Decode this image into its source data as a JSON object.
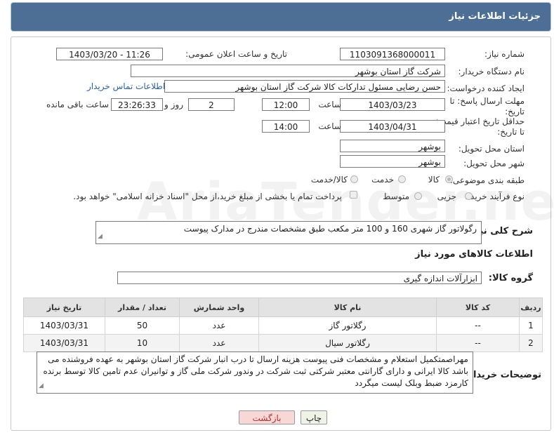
{
  "header": {
    "title": "جزئیات اطلاعات نیاز"
  },
  "watermark": "AriaTender.net",
  "fields": {
    "need_number_label": "شماره نیاز:",
    "need_number": "1103091368000011",
    "announce_label": "تاریخ و ساعت اعلان عمومی:",
    "announce_value": "1403/03/20 - 11:26",
    "buyer_org_label": "نام دستگاه خریدار:",
    "buyer_org": "شرکت گاز استان بوشهر",
    "requester_label": "ایجاد کننده درخواست:",
    "requester": "حسن رضایی مسئول تدارکات کالا شرکت گاز استان بوشهر",
    "contact_link": "اطلاعات تماس خریدار",
    "reply_deadline_label": "مهلت ارسال پاسخ: تا تاریخ:",
    "reply_date": "1403/03/23",
    "time_label": "ساعت",
    "reply_time": "12:00",
    "days_value": "2",
    "days_label": "روز و",
    "remaining_time": "23:26:33",
    "remaining_label": "ساعت باقی مانده",
    "price_validity_label": "حداقل تاریخ اعتبار قیمت: تا تاریخ:",
    "validity_date": "1403/04/31",
    "validity_time": "14:00",
    "province_label": "استان محل تحویل:",
    "province": "بوشهر",
    "city_label": "شهر محل تحویل:",
    "city": "بوشهر",
    "category_label": "طبقه بندی موضوعی:",
    "category_options": [
      "کالا",
      "خدمت",
      "کالا/خدمت"
    ],
    "process_label": "نوع فرآیند خرید :",
    "process_options": [
      "جزیی",
      "متوسط"
    ],
    "payment_note": "پرداخت تمام یا بخشی از مبلغ خرید،از محل \"اسناد خزانه اسلامی\" خواهد بود.",
    "summary_label": "شرح کلی نیاز:",
    "summary": "رگولاتور گاز شهری 160 و 100 متر مکعب طبق مشخصات مندرج در مدارک پیوست",
    "goods_info_title": "اطلاعات کالاهای مورد نیاز",
    "goods_group_label": "گروه کالا:",
    "goods_group": "ابزارآلات اندازه گیری",
    "buyer_notes_label": "توضیحات خریدار:",
    "buyer_notes": "مهراصمتکمیل استعلام و مشخصات فنی پیوست هزینه ارسال تا درب انبار شرکت گاز استان بوشهر به عهده فروشنده می باشد کالا ایرانی و دارای گارانتی معتبر شرکتی ثبت شرکت در وندور شرکت ملی گاز و توانیران عدم تامین کالا توسط برنده کارمزد ضبط وبلک لیست میگردد"
  },
  "table": {
    "headers": [
      "ردیف",
      "کد کالا",
      "نام کالا",
      "واحد شمارش",
      "تعداد / مقدار",
      "تاریخ نیاز"
    ],
    "rows": [
      [
        "1",
        "--",
        "رگلاتور گاز",
        "عدد",
        "50",
        "1403/03/31"
      ],
      [
        "2",
        "--",
        "رگلاتور سیال",
        "عدد",
        "10",
        "1403/03/31"
      ]
    ]
  },
  "buttons": {
    "print": "چاپ",
    "back": "بازگشت"
  },
  "colors": {
    "header_bg": "#4d6f95",
    "back_bg": "#f8d7d7",
    "print_bg": "#eef3e6"
  }
}
